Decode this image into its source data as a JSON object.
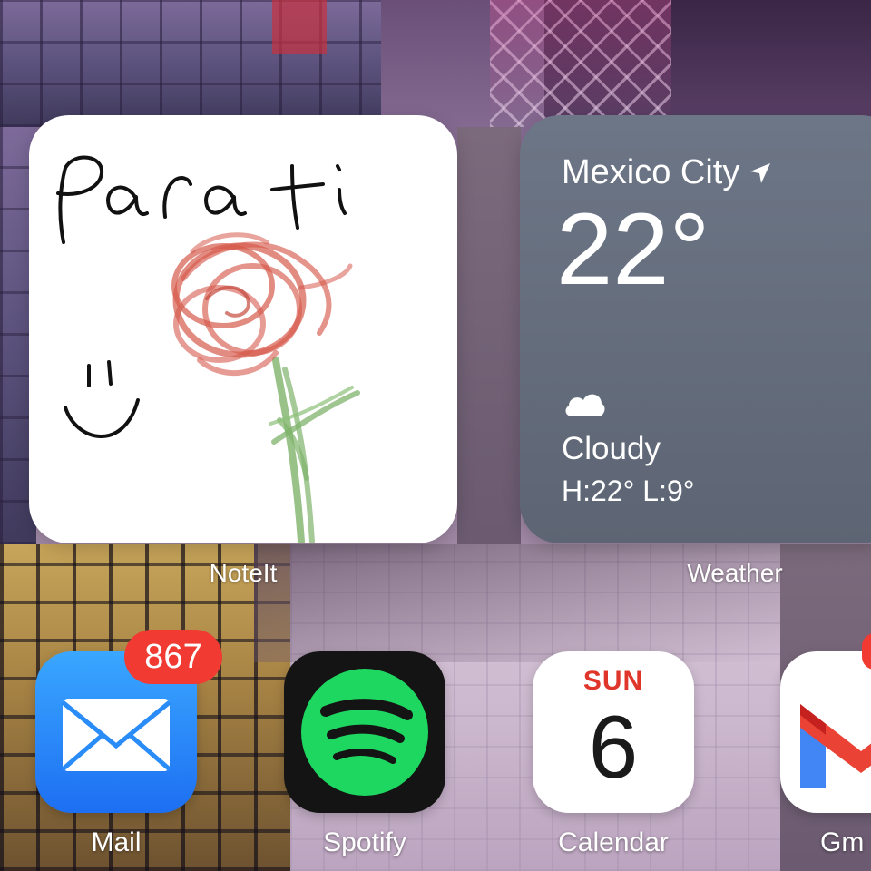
{
  "widgets": {
    "noteit": {
      "label": "NoteIt",
      "note_text": "Para ti",
      "drawing": [
        "smiley-face",
        "red-rose",
        "green-stem"
      ]
    },
    "weather": {
      "label": "Weather",
      "city": "Mexico City",
      "location_icon": "location-arrow-icon",
      "temperature": "22°",
      "condition_icon": "cloud-icon",
      "condition": "Cloudy",
      "high_low": "H:22° L:9°",
      "background_color": "#666f7e"
    }
  },
  "apps": [
    {
      "name": "Mail",
      "icon": "envelope-icon",
      "badge": "867",
      "color": "#2a8cf8"
    },
    {
      "name": "Spotify",
      "icon": "spotify-icon",
      "color": "#1ed760"
    },
    {
      "name": "Calendar",
      "icon": "calendar-icon",
      "day": "SUN",
      "date": "6"
    },
    {
      "name": "Gm",
      "icon": "gmail-icon"
    }
  ],
  "colors": {
    "badge": "#f03a32",
    "calendar_day": "#e0352b"
  }
}
